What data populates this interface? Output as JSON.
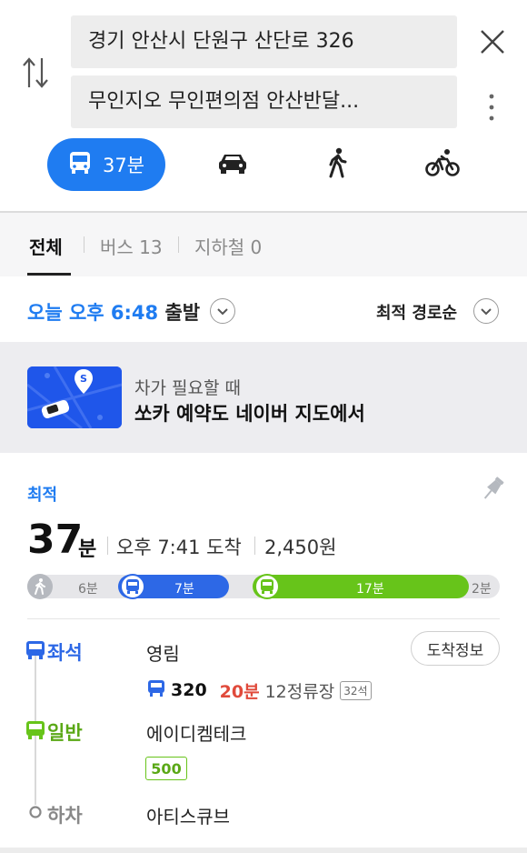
{
  "search": {
    "origin": "경기 안산시 단원구 산단로 326",
    "destination": "무인지오 무인편의점 안산반달..."
  },
  "modes": [
    {
      "icon": "bus-icon",
      "label": "37분",
      "active": true
    },
    {
      "icon": "car-icon",
      "active": false
    },
    {
      "icon": "walk-icon",
      "active": false
    },
    {
      "icon": "bike-icon",
      "active": false
    }
  ],
  "tabs": {
    "all": "전체",
    "bus": "버스 13",
    "subway": "지하철 0"
  },
  "depart": {
    "time": "오늘 오후 6:48",
    "suffix": "출발"
  },
  "sort": "최적 경로순",
  "banner": {
    "subtitle": "차가 필요할 때",
    "title": "쏘카 예약도 네이버 지도에서"
  },
  "route": {
    "badge": "최적",
    "duration_value": "37",
    "duration_unit": "분",
    "arrival": "오후 7:41 도착",
    "fare": "2,450원",
    "segments": {
      "walk1": "6분",
      "bus_blue": "7분",
      "bus_green": "17분",
      "walk2": "2분"
    },
    "steps": {
      "seat_label": "좌석",
      "seat_stop": "영림",
      "arrival_info_button": "도착정보",
      "bus_number": "320",
      "bus_wait": "20분",
      "bus_stops": "12정류장",
      "seat_count": "32석",
      "general_label": "일반",
      "general_stop": "에이디켐테크",
      "general_bus_number": "500",
      "alight_label": "하차",
      "alight_stop": "아티스큐브"
    }
  },
  "colors": {
    "accent_blue": "#1f7cf1",
    "bus_blue": "#2d68e6",
    "bus_green": "#67c41a",
    "wait_red": "#e04a3b"
  }
}
